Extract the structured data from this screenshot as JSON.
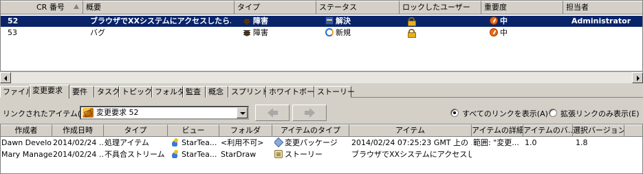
{
  "top_grid": {
    "columns": [
      "CR 番号",
      "概要",
      "タイプ",
      "ステータス",
      "ロックしたユーザー",
      "重要度",
      "担当者"
    ],
    "rows": [
      {
        "num": "52",
        "summary": "ブラウザでXXシステムにアクセスしたら...",
        "type": "障害",
        "type_icon": "bug-icon",
        "status": "解決",
        "status_icon": "resolved-icon",
        "lock_icon": "lock-icon",
        "severity": "中",
        "severity_icon": "priority-icon",
        "assignee": "Administrator",
        "selected": true
      },
      {
        "num": "53",
        "summary": "バグ",
        "type": "障害",
        "type_icon": "bug-icon",
        "status": "新規",
        "status_icon": "new-icon",
        "lock_icon": "lock-icon",
        "severity": "中",
        "severity_icon": "priority-icon",
        "assignee": "",
        "selected": false
      }
    ]
  },
  "tabs": [
    "ファイル",
    "変更要求",
    "要件",
    "タスク",
    "トピック",
    "フォルダ",
    "監査",
    "概念",
    "スプリント",
    "ホワイトボード",
    "ストーリー"
  ],
  "active_tab": "変更要求",
  "linkbar": {
    "label": "リンクされたアイテム(L):",
    "combo_value": "変更要求 52",
    "radio_all": "すべてのリンクを表示(A)",
    "radio_ext": "拡張リンクのみ表示(E)",
    "radio_selected": "all"
  },
  "bottom_grid": {
    "columns": [
      "作成者",
      "作成日時",
      "タイプ",
      "ビュー",
      "フォルダ",
      "アイテムのタイプ",
      "アイテム",
      "アイテムの詳細",
      "アイテムのバ...",
      "選択バージョン"
    ],
    "rows": [
      {
        "author": "Dawn Develo...",
        "created": "2014/02/24 ...",
        "type": "処理アイテム",
        "view": "StarTea...",
        "folder": "<利用不可>",
        "item_type": "変更パッケージ",
        "item": "2014/02/24 07:25:23 GMT 上の ...",
        "details": "範囲: \"変更...",
        "item_ver": "1.0",
        "sel_ver": "1.8"
      },
      {
        "author": "Mary Manager",
        "created": "2014/02/24 ...",
        "type": "不具合ストリーム",
        "view": "StarTea...",
        "folder": "StarDraw",
        "item_type": "ストーリー",
        "item": "ブラウザでXXシステムにアクセスした...",
        "details": "",
        "item_ver": "",
        "sel_ver": ""
      }
    ]
  },
  "colors": {
    "selection": "#0a246a",
    "face": "#d4d0c8"
  }
}
